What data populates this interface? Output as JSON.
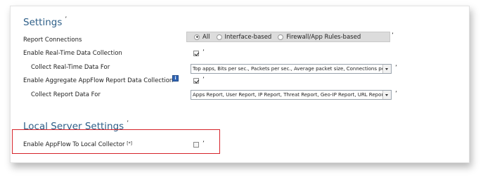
{
  "settings": {
    "title": "Settings",
    "rows": {
      "report_connections": {
        "label": "Report Connections",
        "options": [
          "All",
          "Interface-based",
          "Firewall/App Rules-based"
        ],
        "selected": "All"
      },
      "realtime": {
        "label": "Enable Real-Time Data Collection",
        "checked": true
      },
      "realtime_for": {
        "label": "Collect Real-Time Data For",
        "value": "Top apps, Bits per sec., Packets per sec., Average packet size, Connections per"
      },
      "aggregate": {
        "label": "Enable Aggregate AppFlow Report Data Collection",
        "checked": true
      },
      "report_for": {
        "label": "Collect Report Data For",
        "value": "Apps Report, User Report, IP Report, Threat Report, Geo-IP Report, URL Report"
      }
    }
  },
  "local_server": {
    "title": "Local Server Settings",
    "enable_label": "Enable AppFlow To Local Collector",
    "enable_note": "[*]",
    "checked": false
  },
  "marks": {
    "tick": "ʼ"
  },
  "icons": {
    "info": "info-icon"
  },
  "colors": {
    "section_title": "#2e5f88",
    "highlight_border": "#d6232a",
    "radio_bar_bg": "#dcdcdc",
    "info_icon": "#3266b5"
  }
}
